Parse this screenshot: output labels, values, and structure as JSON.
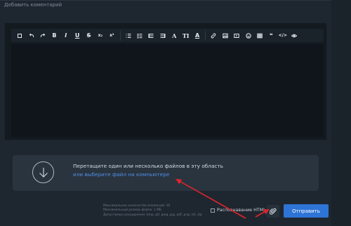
{
  "comment": {
    "label": "Добавить коментарий"
  },
  "toolbar": {
    "groups": [
      [
        {
          "name": "fullscreen",
          "icon": "square-icon",
          "glyph": ""
        },
        {
          "name": "undo",
          "icon": "undo-icon",
          "glyph": ""
        },
        {
          "name": "redo",
          "icon": "redo-icon",
          "glyph": ""
        },
        {
          "name": "bold",
          "icon": "bold-icon",
          "glyph": "B"
        },
        {
          "name": "italic",
          "icon": "italic-icon",
          "glyph": "I"
        },
        {
          "name": "underline",
          "icon": "underline-icon",
          "glyph": "U"
        },
        {
          "name": "strikethrough",
          "icon": "strikethrough-icon",
          "glyph": "S"
        },
        {
          "name": "subscript",
          "icon": "subscript-icon",
          "glyph": "x₂"
        },
        {
          "name": "superscript",
          "icon": "superscript-icon",
          "glyph": "x²"
        }
      ],
      [
        {
          "name": "ordered-list",
          "icon": "ordered-list-icon",
          "glyph": ""
        },
        {
          "name": "unordered-list",
          "icon": "unordered-list-icon",
          "glyph": ""
        },
        {
          "name": "align-left",
          "icon": "align-left-icon",
          "glyph": ""
        },
        {
          "name": "align-center",
          "icon": "align-center-icon",
          "glyph": ""
        },
        {
          "name": "font-size",
          "icon": "font-size-icon",
          "glyph": "A"
        },
        {
          "name": "text-size",
          "icon": "text-size-icon",
          "glyph": "TI"
        },
        {
          "name": "font-color",
          "icon": "font-color-icon",
          "glyph": "A"
        }
      ],
      [
        {
          "name": "link",
          "icon": "link-icon",
          "glyph": ""
        },
        {
          "name": "image",
          "icon": "image-icon",
          "glyph": ""
        },
        {
          "name": "video",
          "icon": "video-icon",
          "glyph": ""
        },
        {
          "name": "emoji",
          "icon": "emoji-icon",
          "glyph": ""
        },
        {
          "name": "table",
          "icon": "table-icon",
          "glyph": ""
        },
        {
          "name": "quote",
          "icon": "quote-icon",
          "glyph": "❝"
        },
        {
          "name": "code",
          "icon": "code-icon",
          "glyph": "</>"
        },
        {
          "name": "preview",
          "icon": "eye-icon",
          "glyph": ""
        }
      ]
    ]
  },
  "dropzone": {
    "icon": "arrow-down-circle-icon",
    "primary_text": "Перетащите один или несколько файлов в эту область",
    "link_text": "или выберите файл на компьютере"
  },
  "limits": {
    "max_attachments": "Максимальное количество вложений: 10",
    "max_size": "Максимальный размер файла: 1 МБ",
    "extensions": "Допустимые расширения: bmp, gif, jpeg, jpg, pdf, png, txt, zip"
  },
  "footer": {
    "html_toggle_label": "Распознавание HTML",
    "html_toggle_checked": false,
    "attach_icon": "paperclip-icon",
    "submit_label": "Отправить"
  },
  "colors": {
    "background": "#1e2730",
    "editor_area": "#0f151a",
    "dropzone": "#2a343f",
    "link": "#4f8fe6",
    "submit": "#2e74d6",
    "annotation": "#e0242c"
  }
}
